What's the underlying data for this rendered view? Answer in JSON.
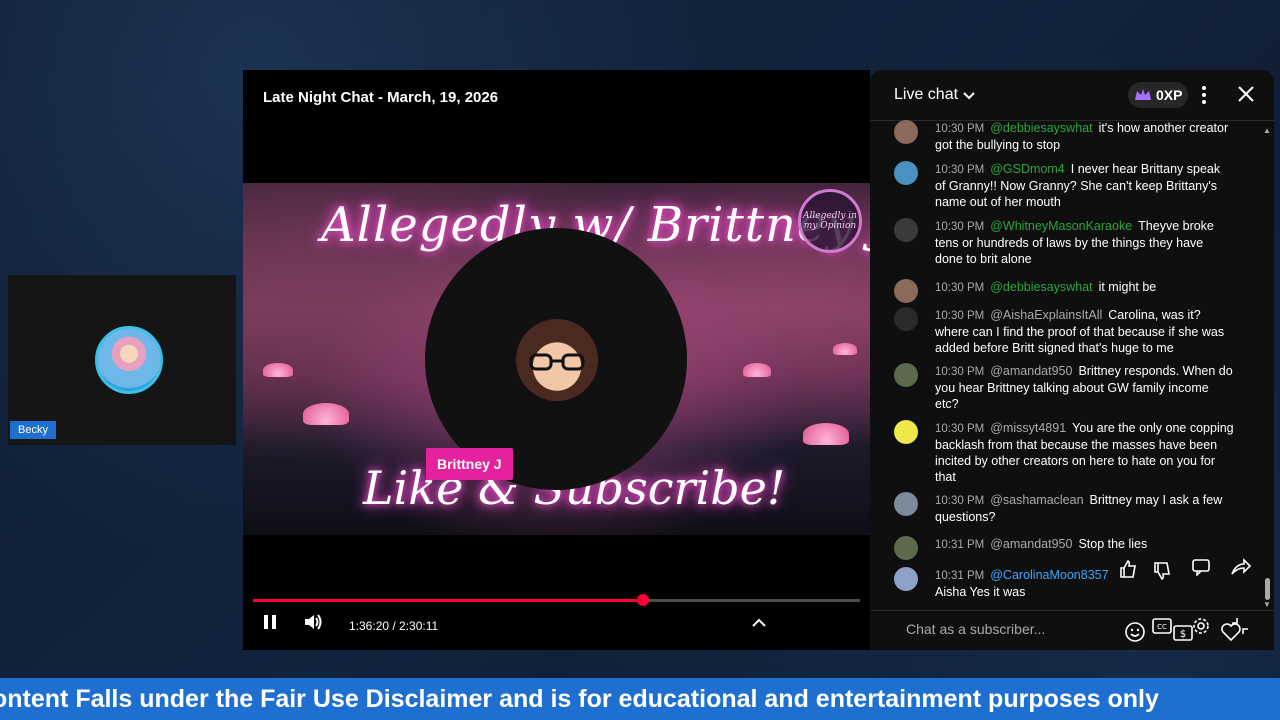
{
  "guest": {
    "name": "Becky"
  },
  "video": {
    "title": "Late Night Chat - March, 19, 2026",
    "overlay_top_text": "Allegedly w/ Brittney J",
    "overlay_bottom_text": "Like & Subscribe!",
    "seal_text": "Allegedly in my Opinion",
    "host_name": "Brittney J",
    "time_display": "1:36:20 / 2:30:11",
    "progress_fraction": 0.642,
    "icons": [
      "pause-icon",
      "volume-icon",
      "chevron-up-icon"
    ]
  },
  "chat": {
    "title": "Live chat",
    "xp_label": "0XP",
    "input_placeholder": "Chat as a subscriber...",
    "messages": [
      {
        "time": "10:30 PM",
        "author": "@debbiesayswhat",
        "text": "it's how another creator got the bullying to stop"
      },
      {
        "time": "10:30 PM",
        "author": "@GSDmom4",
        "text": "I never hear Brittany speak of Granny!! Now Granny? She can't keep Brittany's name out of her mouth"
      },
      {
        "time": "10:30 PM",
        "author": "@WhitneyMasonKaraoke",
        "text": "Theyve broke tens or hundreds of laws by the things they have done to brit alone"
      },
      {
        "time": "10:30 PM",
        "author": "@debbiesayswhat",
        "text": "it might be"
      },
      {
        "time": "10:30 PM",
        "author": "@AishaExplainsItAll",
        "text": "Carolina, was it? where can I find the proof of that because if she was added before Britt signed that's huge to me"
      },
      {
        "time": "10:30 PM",
        "author": "@amandat950",
        "text": "Brittney responds. When do you hear Brittney talking about GW family income etc?"
      },
      {
        "time": "10:30 PM",
        "author": "@missyt4891",
        "text": "You are the only one copping backlash from that because the masses have been incited by other creators on here to hate on you for that"
      },
      {
        "time": "10:30 PM",
        "author": "@sashamaclean",
        "text": "Brittney may I ask a few questions?"
      },
      {
        "time": "10:31 PM",
        "author": "@amandat950",
        "text": "Stop the lies"
      },
      {
        "time": "10:31 PM",
        "author": "@CarolinaMoon8357",
        "text": "Aisha Yes it was"
      }
    ]
  },
  "ticker": {
    "text": "ontent Falls under the Fair Use Disclaimer and is for educational and entertainment purposes only"
  },
  "colors": {
    "accent_red": "#ff0033",
    "ticker_blue": "#1f6fd1",
    "name_tag_pink": "#e6219d",
    "member_green": "#2ba640"
  }
}
